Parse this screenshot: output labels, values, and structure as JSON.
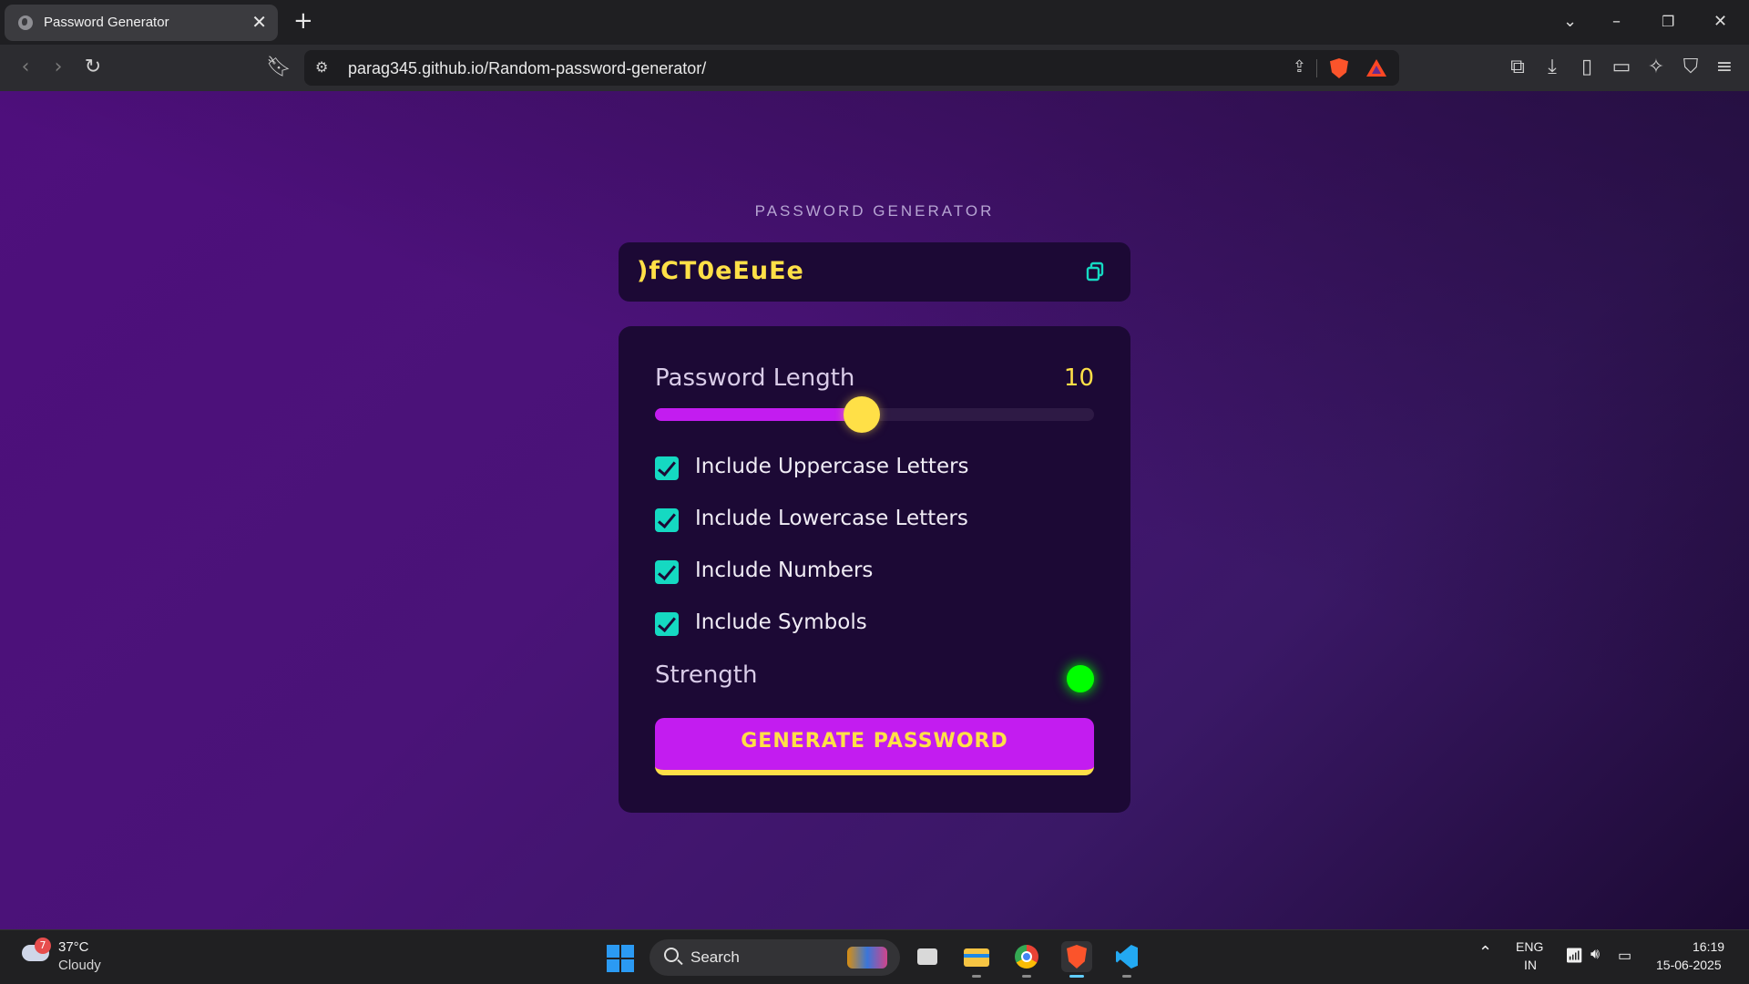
{
  "browser": {
    "tab_title": "Password Generator",
    "tab_close": "✕",
    "new_tab": "+",
    "url": "parag345.github.io/Random-password-generator/"
  },
  "app": {
    "title": "PASSWORD GENERATOR",
    "password": ")fCT0eEuEe",
    "length_label": "Password Length",
    "length_value": "10",
    "length_fraction": 0.47,
    "options": [
      {
        "label": "Include Uppercase Letters",
        "checked": true
      },
      {
        "label": "Include Lowercase Letters",
        "checked": true
      },
      {
        "label": "Include Numbers",
        "checked": true
      },
      {
        "label": "Include Symbols",
        "checked": true
      }
    ],
    "strength_label": "Strength",
    "strength_color": "#00ff00",
    "generate_label": "GENERATE PASSWORD",
    "accent": "#c31cf0",
    "highlight": "#ffe047",
    "check_color": "#15d9c2"
  },
  "taskbar": {
    "weather_badge": "7",
    "temperature": "37°C",
    "condition": "Cloudy",
    "search_label": "Search",
    "language": "ENG",
    "region": "IN",
    "time": "16:19",
    "date": "15-06-2025"
  }
}
